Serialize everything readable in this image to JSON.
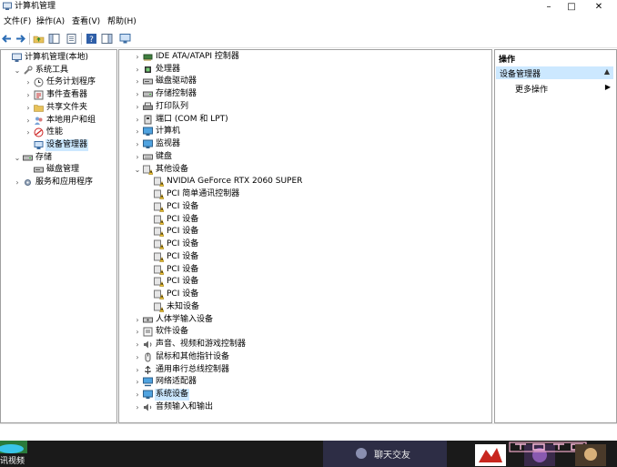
{
  "window": {
    "title": "计算机管理"
  },
  "menu": [
    "文件(F)",
    "操作(A)",
    "查看(V)",
    "帮助(H)"
  ],
  "left_tree": [
    {
      "label": "计算机管理(本地)",
      "indent": 0,
      "arrow": "",
      "icon": "computer"
    },
    {
      "label": "系统工具",
      "indent": 1,
      "arrow": "v",
      "icon": "tools"
    },
    {
      "label": "任务计划程序",
      "indent": 2,
      "arrow": ">",
      "icon": "clock"
    },
    {
      "label": "事件查看器",
      "indent": 2,
      "arrow": ">",
      "icon": "event"
    },
    {
      "label": "共享文件夹",
      "indent": 2,
      "arrow": ">",
      "icon": "folder"
    },
    {
      "label": "本地用户和组",
      "indent": 2,
      "arrow": ">",
      "icon": "users"
    },
    {
      "label": "性能",
      "indent": 2,
      "arrow": ">",
      "icon": "perf"
    },
    {
      "label": "设备管理器",
      "indent": 2,
      "arrow": "",
      "icon": "devmgr",
      "selected": true
    },
    {
      "label": "存储",
      "indent": 1,
      "arrow": "v",
      "icon": "storage"
    },
    {
      "label": "磁盘管理",
      "indent": 2,
      "arrow": "",
      "icon": "disk"
    },
    {
      "label": "服务和应用程序",
      "indent": 1,
      "arrow": ">",
      "icon": "services"
    }
  ],
  "device_tree": [
    {
      "label": "IDE ATA/ATAPI 控制器",
      "indent": 0,
      "arrow": ">",
      "icon": "ide"
    },
    {
      "label": "处理器",
      "indent": 0,
      "arrow": ">",
      "icon": "cpu"
    },
    {
      "label": "磁盘驱动器",
      "indent": 0,
      "arrow": ">",
      "icon": "disk"
    },
    {
      "label": "存储控制器",
      "indent": 0,
      "arrow": ">",
      "icon": "storage"
    },
    {
      "label": "打印队列",
      "indent": 0,
      "arrow": ">",
      "icon": "printer"
    },
    {
      "label": "端口 (COM 和 LPT)",
      "indent": 0,
      "arrow": ">",
      "icon": "port"
    },
    {
      "label": "计算机",
      "indent": 0,
      "arrow": ">",
      "icon": "monitor"
    },
    {
      "label": "监视器",
      "indent": 0,
      "arrow": ">",
      "icon": "monitor"
    },
    {
      "label": "键盘",
      "indent": 0,
      "arrow": ">",
      "icon": "keyboard"
    },
    {
      "label": "其他设备",
      "indent": 0,
      "arrow": "v",
      "icon": "warn"
    },
    {
      "label": "NVIDIA GeForce RTX 2060 SUPER",
      "indent": 1,
      "arrow": "",
      "icon": "warn"
    },
    {
      "label": "PCI 简单通讯控制器",
      "indent": 1,
      "arrow": "",
      "icon": "warn"
    },
    {
      "label": "PCI 设备",
      "indent": 1,
      "arrow": "",
      "icon": "warn"
    },
    {
      "label": "PCI 设备",
      "indent": 1,
      "arrow": "",
      "icon": "warn"
    },
    {
      "label": "PCI 设备",
      "indent": 1,
      "arrow": "",
      "icon": "warn"
    },
    {
      "label": "PCI 设备",
      "indent": 1,
      "arrow": "",
      "icon": "warn"
    },
    {
      "label": "PCI 设备",
      "indent": 1,
      "arrow": "",
      "icon": "warn"
    },
    {
      "label": "PCI 设备",
      "indent": 1,
      "arrow": "",
      "icon": "warn"
    },
    {
      "label": "PCI 设备",
      "indent": 1,
      "arrow": "",
      "icon": "warn"
    },
    {
      "label": "PCI 设备",
      "indent": 1,
      "arrow": "",
      "icon": "warn"
    },
    {
      "label": "未知设备",
      "indent": 1,
      "arrow": "",
      "icon": "warn"
    },
    {
      "label": "人体学输入设备",
      "indent": 0,
      "arrow": ">",
      "icon": "hid"
    },
    {
      "label": "软件设备",
      "indent": 0,
      "arrow": ">",
      "icon": "software"
    },
    {
      "label": "声音、视频和游戏控制器",
      "indent": 0,
      "arrow": ">",
      "icon": "sound"
    },
    {
      "label": "鼠标和其他指针设备",
      "indent": 0,
      "arrow": ">",
      "icon": "mouse"
    },
    {
      "label": "通用串行总线控制器",
      "indent": 0,
      "arrow": ">",
      "icon": "usb"
    },
    {
      "label": "网络适配器",
      "indent": 0,
      "arrow": ">",
      "icon": "network"
    },
    {
      "label": "系统设备",
      "indent": 0,
      "arrow": ">",
      "icon": "system",
      "selected": true
    },
    {
      "label": "音频输入和输出",
      "indent": 0,
      "arrow": ">",
      "icon": "audio"
    }
  ],
  "actions": {
    "title": "操作",
    "selected": "设备管理器",
    "more": "更多操作"
  },
  "taskbar": {
    "chat_label": "聊天交友",
    "net_label": "讯视频"
  }
}
